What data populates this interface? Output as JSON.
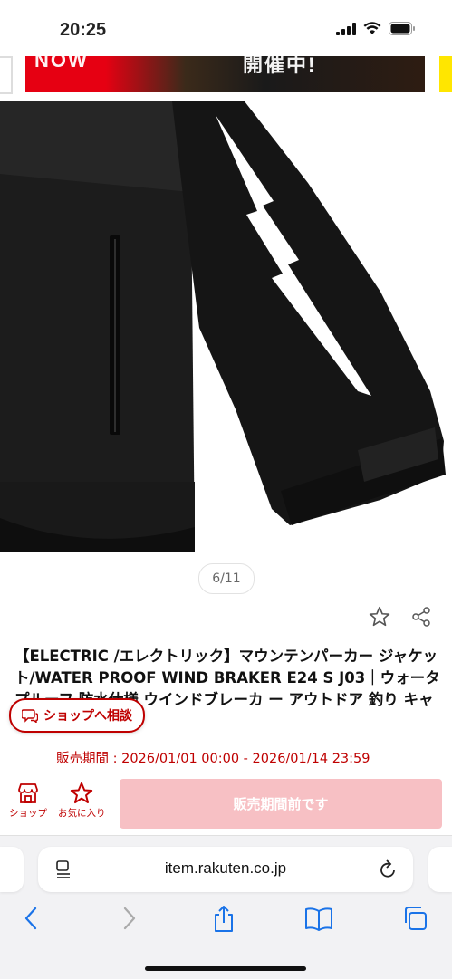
{
  "status": {
    "time": "20:25"
  },
  "banner": {
    "left_text": "NOW",
    "right_text": "開催中!"
  },
  "gallery": {
    "counter": "6/11"
  },
  "product": {
    "title": "【ELECTRIC /エレクトリック】マウンテンパーカー ジャケット/WATER PROOF WIND BRAKER E24 S J03｜ウォータプルーフ 防水仕様 ウインドブレーカ ー アウトドア 釣り キャンプ",
    "chat_label": "ショップへ相談",
    "sale_period": "販売期間 : 2026/01/01 00:00 - 2026/01/14 23:59"
  },
  "bottom_bar": {
    "shop_label": "ショップ",
    "favorite_label": "お気に入り",
    "cart_label": "販売期間前です"
  },
  "browser": {
    "url": "item.rakuten.co.jp"
  },
  "colors": {
    "accent": "#bf0000",
    "cart_disabled": "#f7c0c4"
  }
}
